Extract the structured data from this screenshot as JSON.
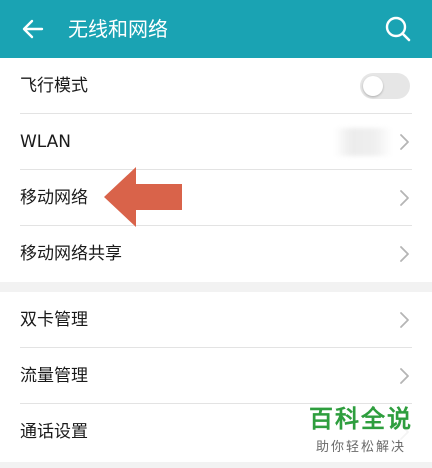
{
  "colors": {
    "appbar": "#1aa3b3",
    "annotation_arrow": "#d9634a",
    "watermark_green": "#2e9e3e"
  },
  "header": {
    "title": "无线和网络",
    "back_icon": "arrow-left-icon",
    "search_icon": "search-icon"
  },
  "group1": {
    "items": [
      {
        "label": "飞行模式",
        "control": "toggle",
        "toggle_on": false
      },
      {
        "label": "WLAN",
        "control": "chevron"
      },
      {
        "label": "移动网络",
        "control": "chevron"
      },
      {
        "label": "移动网络共享",
        "control": "chevron"
      }
    ]
  },
  "group2": {
    "items": [
      {
        "label": "双卡管理",
        "control": "chevron"
      },
      {
        "label": "流量管理",
        "control": "chevron"
      },
      {
        "label": "通话设置",
        "control": "chevron"
      }
    ]
  },
  "watermark": {
    "title": "百科全说",
    "subtitle": "助你轻松解决"
  }
}
